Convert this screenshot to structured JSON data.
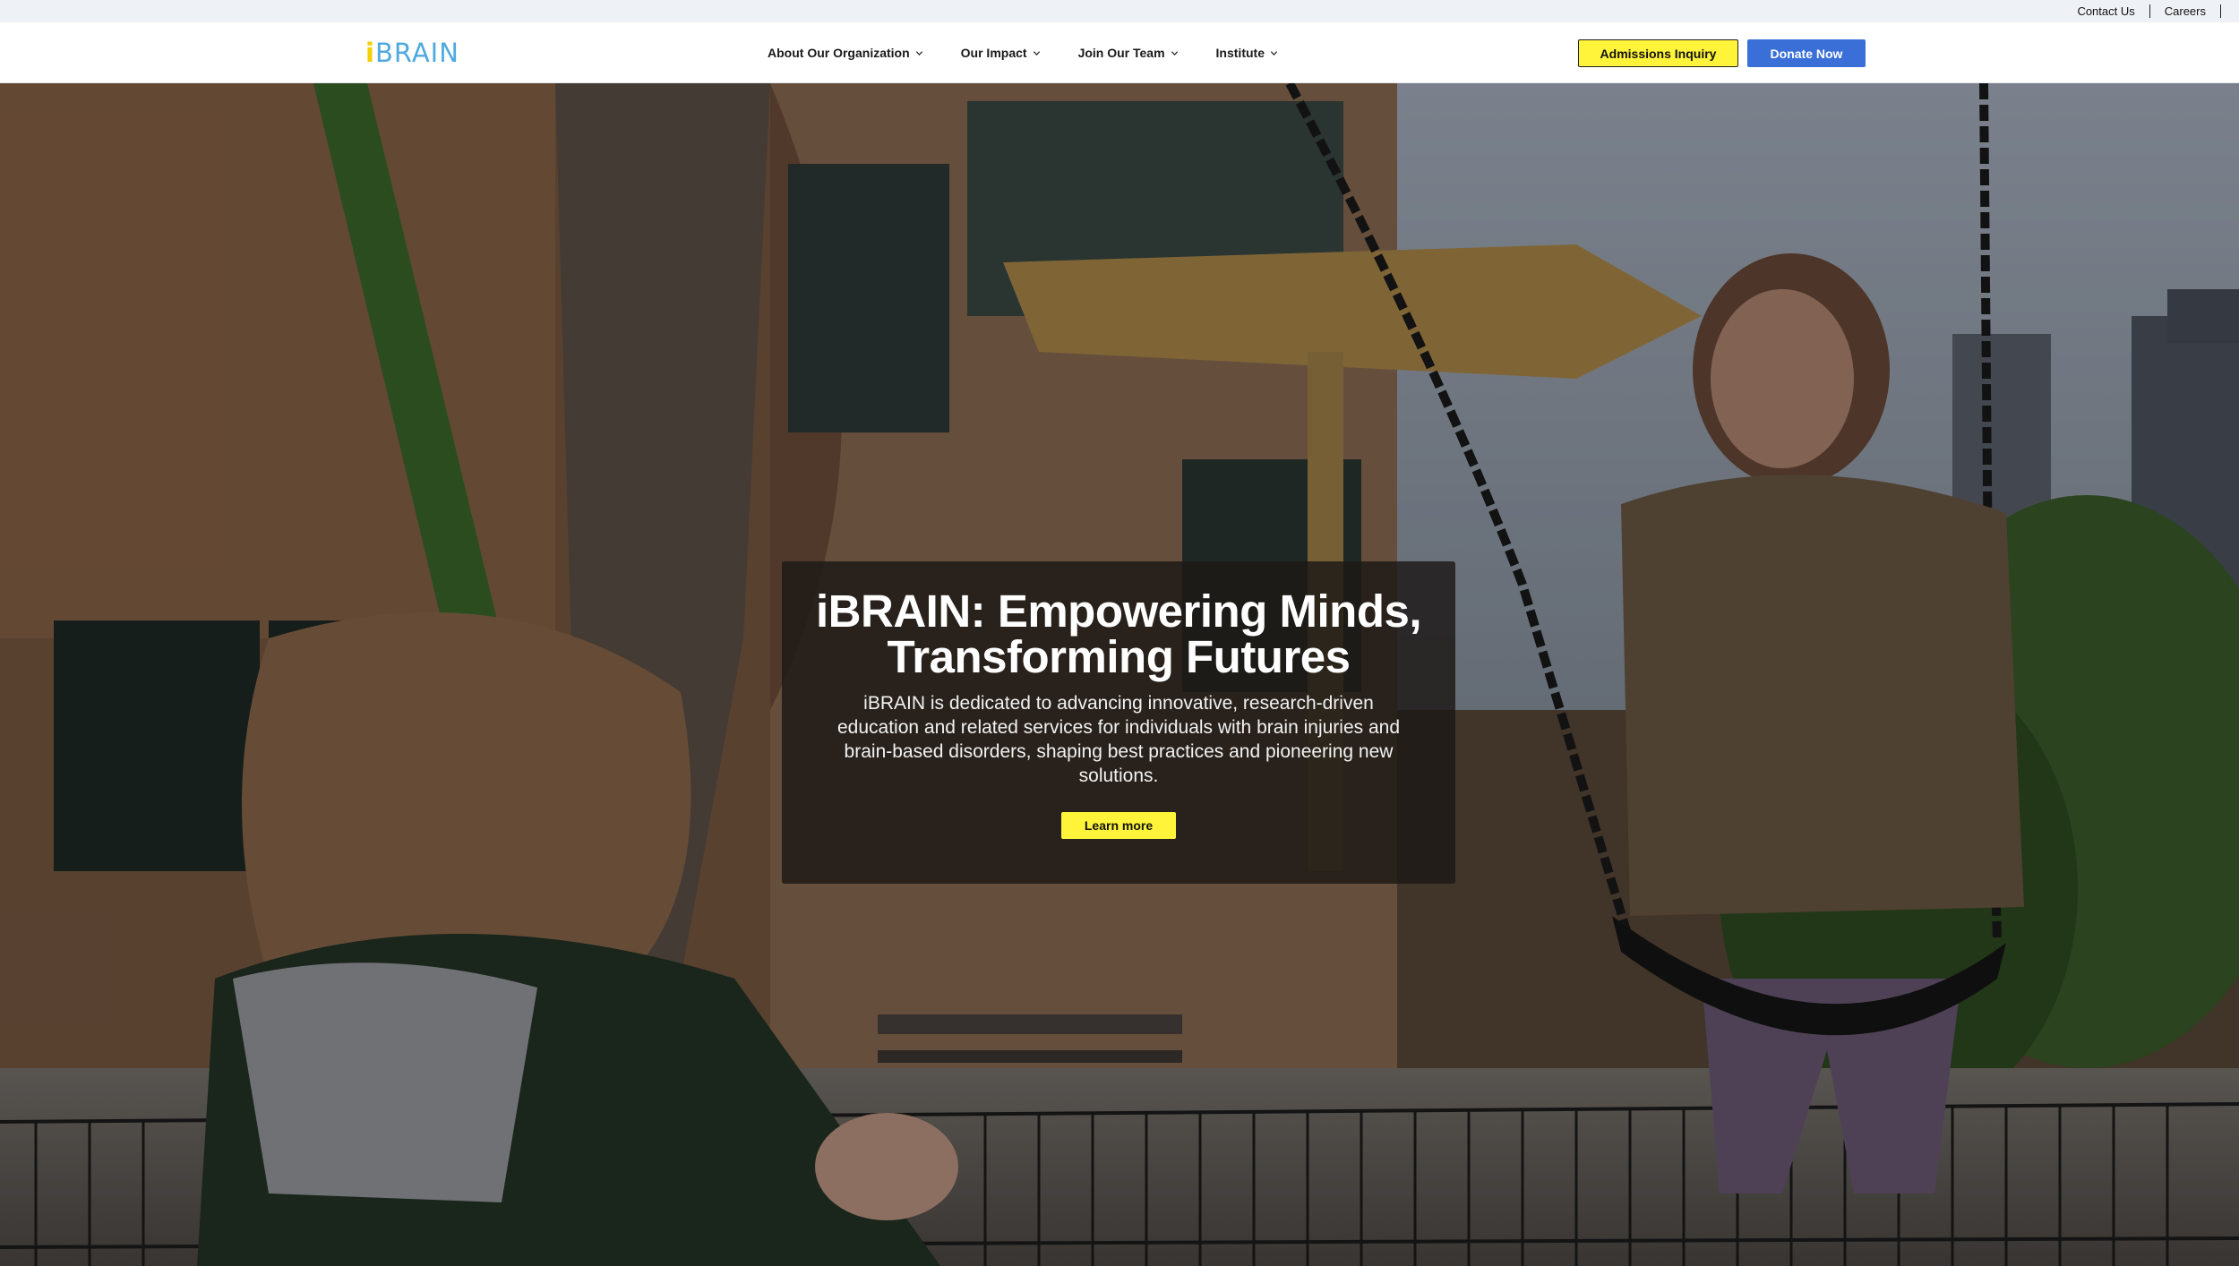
{
  "utility_nav": {
    "contact": "Contact Us",
    "careers": "Careers"
  },
  "header": {
    "logo_i": "i",
    "logo_rest": "BRAIN",
    "menu": [
      {
        "label": "About Our Organization"
      },
      {
        "label": "Our Impact"
      },
      {
        "label": "Join Our Team"
      },
      {
        "label": "Institute"
      }
    ],
    "admissions_label": "Admissions Inquiry",
    "donate_label": "Donate Now"
  },
  "hero": {
    "title_line1": "iBRAIN: Empowering Minds,",
    "title_line2": "Transforming Futures",
    "body": "iBRAIN is dedicated to advancing innovative, research-driven education and related services for individuals with brain injuries and brain-based disorders, shaping best practices and pioneering new solutions.",
    "cta_label": "Learn more"
  },
  "colors": {
    "accent_yellow": "#fff43a",
    "donate_blue": "#3b6fd8",
    "logo_blue": "#4fa9df",
    "utility_bg": "#eef2f7"
  },
  "icons": {
    "dropdown": "chevron-down-icon"
  }
}
